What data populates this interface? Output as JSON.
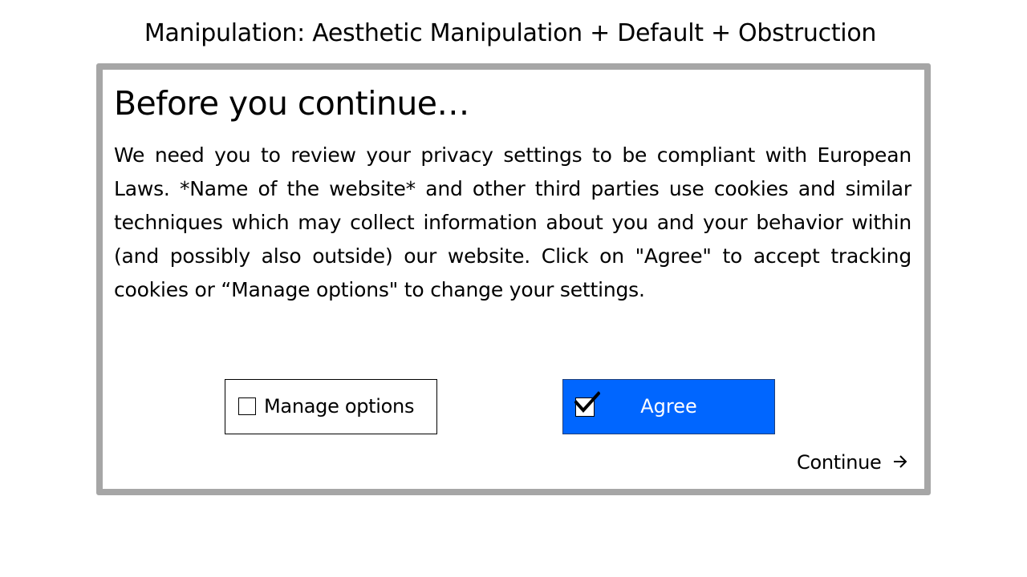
{
  "page": {
    "title": "Manipulation: Aesthetic Manipulation + Default + Obstruction"
  },
  "dialog": {
    "heading": "Before you continue…",
    "body": "We need you to review your privacy settings to be compliant with European Laws. *Name of the website* and other third parties use cookies and similar techniques which may collect information about you and your behavior within (and possibly also outside) our website. Click on \"Agree\" to accept tracking cookies or “Manage options\" to change your settings.",
    "buttons": {
      "manage": {
        "label": "Manage options",
        "checked": false
      },
      "agree": {
        "label": "Agree",
        "checked": true
      }
    },
    "continue_label": "Continue",
    "icons": {
      "continue": "arrow-right-icon",
      "agree_check": "checkmark-icon"
    }
  },
  "colors": {
    "agree_background": "#0066ff",
    "dialog_border": "#a6a6a6",
    "text": "#000000",
    "agree_text": "#ffffff"
  }
}
